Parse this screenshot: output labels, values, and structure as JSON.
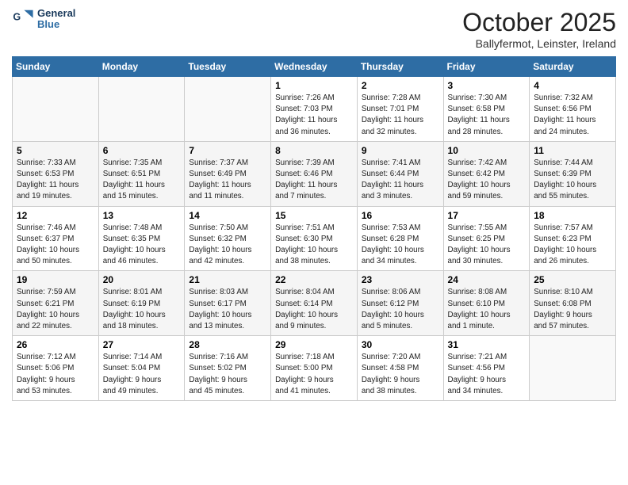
{
  "header": {
    "logo_line1": "General",
    "logo_line2": "Blue",
    "title": "October 2025",
    "location": "Ballyfermot, Leinster, Ireland"
  },
  "weekdays": [
    "Sunday",
    "Monday",
    "Tuesday",
    "Wednesday",
    "Thursday",
    "Friday",
    "Saturday"
  ],
  "weeks": [
    [
      {
        "day": "",
        "info": ""
      },
      {
        "day": "",
        "info": ""
      },
      {
        "day": "",
        "info": ""
      },
      {
        "day": "1",
        "info": "Sunrise: 7:26 AM\nSunset: 7:03 PM\nDaylight: 11 hours\nand 36 minutes."
      },
      {
        "day": "2",
        "info": "Sunrise: 7:28 AM\nSunset: 7:01 PM\nDaylight: 11 hours\nand 32 minutes."
      },
      {
        "day": "3",
        "info": "Sunrise: 7:30 AM\nSunset: 6:58 PM\nDaylight: 11 hours\nand 28 minutes."
      },
      {
        "day": "4",
        "info": "Sunrise: 7:32 AM\nSunset: 6:56 PM\nDaylight: 11 hours\nand 24 minutes."
      }
    ],
    [
      {
        "day": "5",
        "info": "Sunrise: 7:33 AM\nSunset: 6:53 PM\nDaylight: 11 hours\nand 19 minutes."
      },
      {
        "day": "6",
        "info": "Sunrise: 7:35 AM\nSunset: 6:51 PM\nDaylight: 11 hours\nand 15 minutes."
      },
      {
        "day": "7",
        "info": "Sunrise: 7:37 AM\nSunset: 6:49 PM\nDaylight: 11 hours\nand 11 minutes."
      },
      {
        "day": "8",
        "info": "Sunrise: 7:39 AM\nSunset: 6:46 PM\nDaylight: 11 hours\nand 7 minutes."
      },
      {
        "day": "9",
        "info": "Sunrise: 7:41 AM\nSunset: 6:44 PM\nDaylight: 11 hours\nand 3 minutes."
      },
      {
        "day": "10",
        "info": "Sunrise: 7:42 AM\nSunset: 6:42 PM\nDaylight: 10 hours\nand 59 minutes."
      },
      {
        "day": "11",
        "info": "Sunrise: 7:44 AM\nSunset: 6:39 PM\nDaylight: 10 hours\nand 55 minutes."
      }
    ],
    [
      {
        "day": "12",
        "info": "Sunrise: 7:46 AM\nSunset: 6:37 PM\nDaylight: 10 hours\nand 50 minutes."
      },
      {
        "day": "13",
        "info": "Sunrise: 7:48 AM\nSunset: 6:35 PM\nDaylight: 10 hours\nand 46 minutes."
      },
      {
        "day": "14",
        "info": "Sunrise: 7:50 AM\nSunset: 6:32 PM\nDaylight: 10 hours\nand 42 minutes."
      },
      {
        "day": "15",
        "info": "Sunrise: 7:51 AM\nSunset: 6:30 PM\nDaylight: 10 hours\nand 38 minutes."
      },
      {
        "day": "16",
        "info": "Sunrise: 7:53 AM\nSunset: 6:28 PM\nDaylight: 10 hours\nand 34 minutes."
      },
      {
        "day": "17",
        "info": "Sunrise: 7:55 AM\nSunset: 6:25 PM\nDaylight: 10 hours\nand 30 minutes."
      },
      {
        "day": "18",
        "info": "Sunrise: 7:57 AM\nSunset: 6:23 PM\nDaylight: 10 hours\nand 26 minutes."
      }
    ],
    [
      {
        "day": "19",
        "info": "Sunrise: 7:59 AM\nSunset: 6:21 PM\nDaylight: 10 hours\nand 22 minutes."
      },
      {
        "day": "20",
        "info": "Sunrise: 8:01 AM\nSunset: 6:19 PM\nDaylight: 10 hours\nand 18 minutes."
      },
      {
        "day": "21",
        "info": "Sunrise: 8:03 AM\nSunset: 6:17 PM\nDaylight: 10 hours\nand 13 minutes."
      },
      {
        "day": "22",
        "info": "Sunrise: 8:04 AM\nSunset: 6:14 PM\nDaylight: 10 hours\nand 9 minutes."
      },
      {
        "day": "23",
        "info": "Sunrise: 8:06 AM\nSunset: 6:12 PM\nDaylight: 10 hours\nand 5 minutes."
      },
      {
        "day": "24",
        "info": "Sunrise: 8:08 AM\nSunset: 6:10 PM\nDaylight: 10 hours\nand 1 minute."
      },
      {
        "day": "25",
        "info": "Sunrise: 8:10 AM\nSunset: 6:08 PM\nDaylight: 9 hours\nand 57 minutes."
      }
    ],
    [
      {
        "day": "26",
        "info": "Sunrise: 7:12 AM\nSunset: 5:06 PM\nDaylight: 9 hours\nand 53 minutes."
      },
      {
        "day": "27",
        "info": "Sunrise: 7:14 AM\nSunset: 5:04 PM\nDaylight: 9 hours\nand 49 minutes."
      },
      {
        "day": "28",
        "info": "Sunrise: 7:16 AM\nSunset: 5:02 PM\nDaylight: 9 hours\nand 45 minutes."
      },
      {
        "day": "29",
        "info": "Sunrise: 7:18 AM\nSunset: 5:00 PM\nDaylight: 9 hours\nand 41 minutes."
      },
      {
        "day": "30",
        "info": "Sunrise: 7:20 AM\nSunset: 4:58 PM\nDaylight: 9 hours\nand 38 minutes."
      },
      {
        "day": "31",
        "info": "Sunrise: 7:21 AM\nSunset: 4:56 PM\nDaylight: 9 hours\nand 34 minutes."
      },
      {
        "day": "",
        "info": ""
      }
    ]
  ]
}
